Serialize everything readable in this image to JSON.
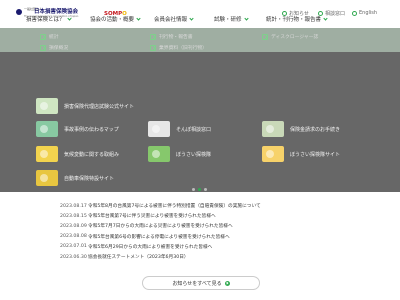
{
  "header": {
    "org_small": "一般社団法人",
    "org_name": "日本損害保険協会",
    "org_english": "The General Insurance Association of Japan",
    "partner_logo": "SOMPO",
    "utility_links": [
      {
        "label": "お知らせ",
        "icon": "bell-icon"
      },
      {
        "label": "相談窓口",
        "icon": "phone-icon"
      },
      {
        "label": "English",
        "icon": "globe-icon"
      }
    ],
    "nav": [
      {
        "label": "損害保険とは？"
      },
      {
        "label": "協会の活動・概要"
      },
      {
        "label": "会員会社情報"
      },
      {
        "label": "試験・研修"
      },
      {
        "label": "統計・刊行物・報告書"
      }
    ]
  },
  "mega_menu": {
    "links": [
      {
        "label": "統計"
      },
      {
        "label": "刊行物・報告書"
      },
      {
        "label": "ディスクロージャー誌"
      },
      {
        "label": "損保概況"
      },
      {
        "label": "業界資料（旧刊行物）"
      }
    ],
    "cards": [
      {
        "label": "損害保険代理店試験公式サイト"
      },
      {
        "label": "事故事例の伝わるマップ"
      },
      {
        "label": "そんぽ相談窓口"
      },
      {
        "label": "保険金請求のお手続き"
      },
      {
        "label": "気候変動に関する取組み"
      },
      {
        "label": "ぼうさい探検隊"
      },
      {
        "label": "ぼうさい探検隊サイト"
      },
      {
        "label": "自動車保険特設サイト"
      }
    ],
    "active_dot": 1,
    "dot_count": 3
  },
  "news": {
    "items": [
      {
        "date": "2023.08.17",
        "text": "令和5年8月の台風第7号による被害に伴う特別措置（自賠責保険）の実施について"
      },
      {
        "date": "2023.08.15",
        "text": "令和5年台風第7号に伴う災害により被害を受けられた皆様へ"
      },
      {
        "date": "2023.08.09",
        "text": "令和5年7月7日からの大雨による災害により被害を受けられた皆様へ"
      },
      {
        "date": "2023.08.08",
        "text": "令和5年台風第6号の影響による停電により被害を受けられた皆様へ"
      },
      {
        "date": "2023.07.01",
        "text": "令和5年6月29日からの大雨により被害を受けられた皆様へ"
      },
      {
        "date": "2023.06.30",
        "text": "協会長就任ステートメント（2023年6月30日）"
      }
    ],
    "all_button": "お知らせをすべて見る"
  }
}
